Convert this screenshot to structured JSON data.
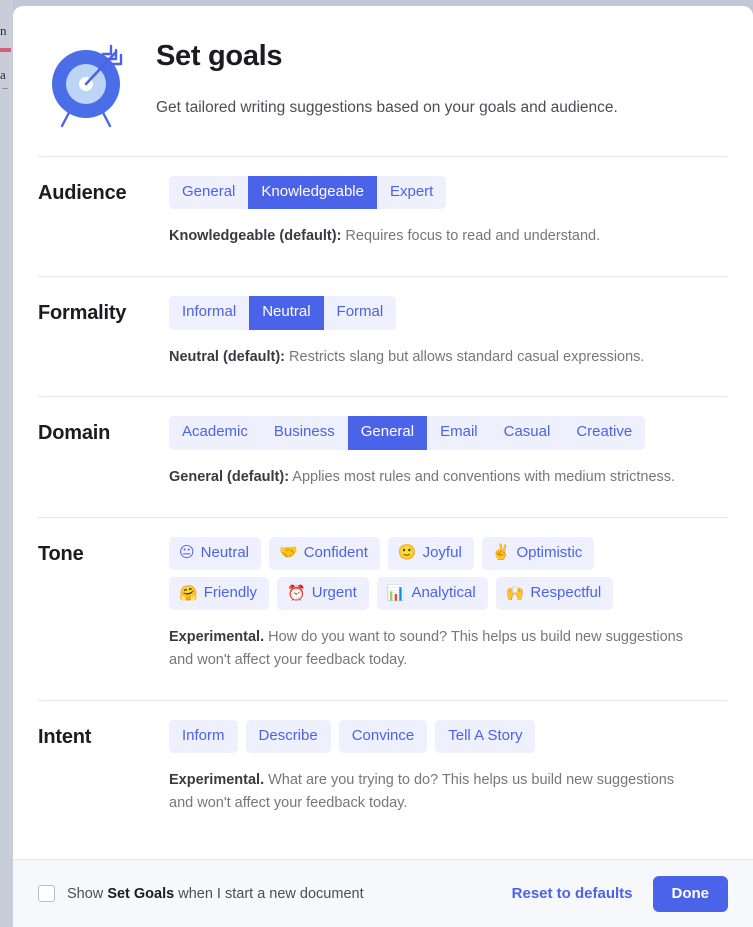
{
  "colors": {
    "accent": "#4b63e8",
    "chip_bg": "#eef0fd",
    "text_dark": "#1b1b21",
    "text_muted": "#76767f",
    "footer_bg": "#f7f8fc",
    "backdrop": "#c3c6d4"
  },
  "header": {
    "icon": "target-with-arrow-icon",
    "title": "Set goals",
    "subtitle": "Get tailored writing suggestions based on your goals and audience."
  },
  "sections": {
    "audience": {
      "label": "Audience",
      "options": [
        {
          "label": "General",
          "selected": false
        },
        {
          "label": "Knowledgeable",
          "selected": true
        },
        {
          "label": "Expert",
          "selected": false
        }
      ],
      "helper_strong": "Knowledgeable (default):",
      "helper_rest": " Requires focus to read and understand."
    },
    "formality": {
      "label": "Formality",
      "options": [
        {
          "label": "Informal",
          "selected": false
        },
        {
          "label": "Neutral",
          "selected": true
        },
        {
          "label": "Formal",
          "selected": false
        }
      ],
      "helper_strong": "Neutral (default):",
      "helper_rest": " Restricts slang but allows standard casual expressions."
    },
    "domain": {
      "label": "Domain",
      "options": [
        {
          "label": "Academic",
          "selected": false
        },
        {
          "label": "Business",
          "selected": false
        },
        {
          "label": "General",
          "selected": true
        },
        {
          "label": "Email",
          "selected": false
        },
        {
          "label": "Casual",
          "selected": false
        },
        {
          "label": "Creative",
          "selected": false
        }
      ],
      "helper_strong": "General (default):",
      "helper_rest": " Applies most rules and conventions with medium strictness."
    },
    "tone": {
      "label": "Tone",
      "rows": [
        [
          {
            "emoji": "😐",
            "icon": "neutral-face-icon",
            "label": "Neutral",
            "selected": false
          },
          {
            "emoji": "🤝",
            "icon": "handshake-icon",
            "label": "Confident",
            "selected": false
          },
          {
            "emoji": "🙂",
            "icon": "smiling-face-icon",
            "label": "Joyful",
            "selected": false
          },
          {
            "emoji": "✌️",
            "icon": "victory-hand-icon",
            "label": "Optimistic",
            "selected": false
          }
        ],
        [
          {
            "emoji": "🤗",
            "icon": "hugging-face-icon",
            "label": "Friendly",
            "selected": false
          },
          {
            "emoji": "⏰",
            "icon": "alarm-clock-icon",
            "label": "Urgent",
            "selected": false
          },
          {
            "emoji": "📊",
            "icon": "bar-chart-icon",
            "label": "Analytical",
            "selected": false
          },
          {
            "emoji": "🙌",
            "icon": "raising-hands-icon",
            "label": "Respectful",
            "selected": false
          }
        ]
      ],
      "helper_strong": "Experimental.",
      "helper_rest": " How do you want to sound? This helps us build new suggestions and won't affect your feedback today."
    },
    "intent": {
      "label": "Intent",
      "options": [
        {
          "label": "Inform",
          "selected": false
        },
        {
          "label": "Describe",
          "selected": false
        },
        {
          "label": "Convince",
          "selected": false
        },
        {
          "label": "Tell A Story",
          "selected": false
        }
      ],
      "helper_strong": "Experimental.",
      "helper_rest": " What are you trying to do? This helps us build new suggestions and won't affect your feedback today."
    }
  },
  "footer": {
    "checkbox_checked": false,
    "checkbox_prefix": "Show ",
    "checkbox_strong": "Set Goals",
    "checkbox_suffix": " when I start a new document",
    "reset_label": "Reset to defaults",
    "done_label": "Done"
  }
}
